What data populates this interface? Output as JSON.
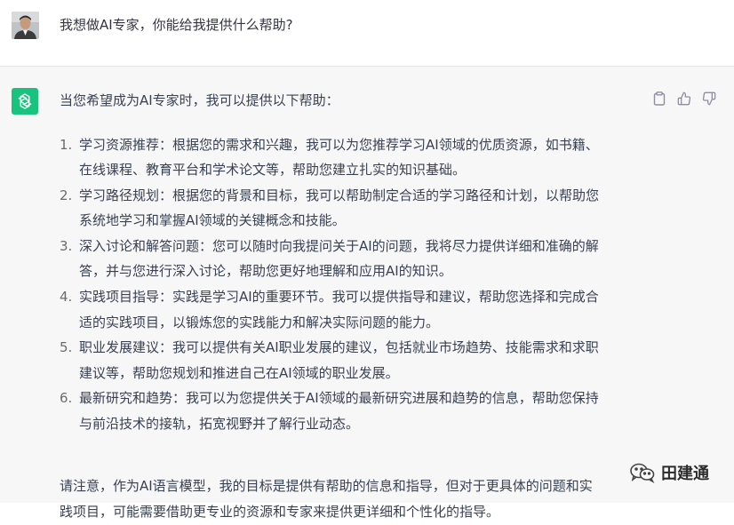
{
  "user": {
    "avatar": "user-avatar",
    "message": "我想做AI专家，你能给我提供什么帮助?"
  },
  "assistant": {
    "avatar": "chatgpt-logo-icon",
    "feedback_icons": [
      "clipboard-icon",
      "thumbs-up-icon",
      "thumbs-down-icon"
    ],
    "intro": "当您希望成为AI专家时，我可以提供以下帮助：",
    "items": [
      {
        "num": "1.",
        "line1": "学习资源推荐：根据您的需求和兴趣，我可以为您推荐学习AI领域的优质资源，如书籍、",
        "line2": "在线课程、教育平台和学术论文等，帮助您建立扎实的知识基础。"
      },
      {
        "num": "2.",
        "line1": "学习路径规划：根据您的背景和目标，我可以帮助制定合适的学习路径和计划，以帮助您",
        "line2": "系统地学习和掌握AI领域的关键概念和技能。"
      },
      {
        "num": "3.",
        "line1": "深入讨论和解答问题：您可以随时向我提问关于AI的问题，我将尽力提供详细和准确的解",
        "line2": "答，并与您进行深入讨论，帮助您更好地理解和应用AI的知识。"
      },
      {
        "num": "4.",
        "line1": "实践项目指导：实践是学习AI的重要环节。我可以提供指导和建议，帮助您选择和完成合",
        "line2": "适的实践项目，以锻炼您的实践能力和解决实际问题的能力。"
      },
      {
        "num": "5.",
        "line1": "职业发展建议：我可以提供有关AI职业发展的建议，包括就业市场趋势、技能需求和求职",
        "line2": "建议等，帮助您规划和推进自己在AI领域的职业发展。"
      },
      {
        "num": "6.",
        "line1": "最新研究和趋势：我可以为您提供关于AI领域的最新研究进展和趋势的信息，帮助您保持",
        "line2": "与前沿技术的接轨，拓宽视野并了解行业动态。"
      }
    ],
    "note_line1": "请注意，作为AI语言模型，我的目标是提供有帮助的信息和指导，但对于更具体的问题和实",
    "note_line2": "践项目，可能需要借助更专业的资源和专家来提供更详细和个性化的指导。"
  },
  "watermark": {
    "icon": "wechat-icon",
    "text": "田建通"
  },
  "colors": {
    "gpt_green": "#19c37d",
    "assistant_bg": "#f7f7f8",
    "text": "#374151"
  }
}
